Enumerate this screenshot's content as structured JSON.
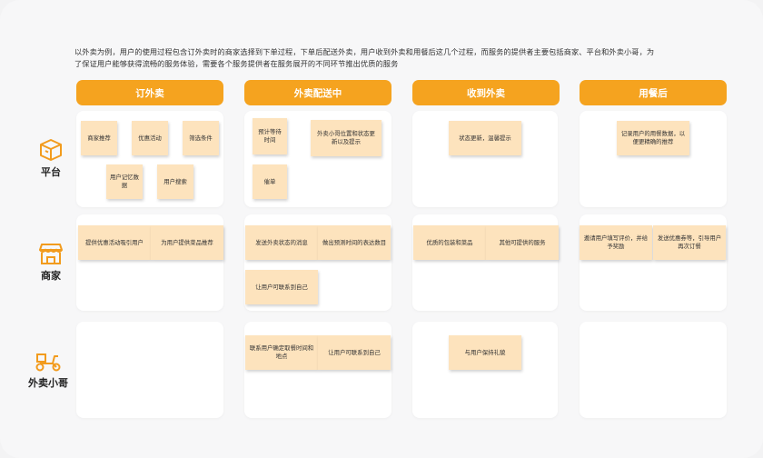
{
  "intro": {
    "line1": "以外卖为例，用户的使用过程包含订外卖时的商家选择到下单过程，下单后配送外卖，用户收到外卖和用餐后这几个过程，而服务的提供者主要包括商家、平台和外卖小哥，为",
    "line2": "了保证用户能够获得流畅的服务体验，需要各个服务提供者在服务展开的不同环节推出优质的服务"
  },
  "stages": [
    "订外卖",
    "外卖配送中",
    "收到外卖",
    "用餐后"
  ],
  "roles": [
    {
      "label": "平台",
      "icon": "store-box-icon"
    },
    {
      "label": "商家",
      "icon": "shop-icon"
    },
    {
      "label": "外卖小哥",
      "icon": "scooter-icon"
    }
  ],
  "notes": {
    "platform_order": [
      "商家推荐",
      "优惠活动",
      "筛选条件",
      "用户记忆数据",
      "用户搜索"
    ],
    "platform_delivery": [
      "预计等待时间",
      "外卖小哥位置和状态更新以及提示",
      "催单"
    ],
    "platform_receive": [
      "状态更新，温馨提示"
    ],
    "platform_after": [
      "记录用户的用餐数据，以便更精确的推荐"
    ],
    "merchant_order": [
      "提供优惠活动吸引用户",
      "为用户提供菜品推荐"
    ],
    "merchant_delivery": [
      "发送外卖状态的消息",
      "做出预测时间的表达数目",
      "让用户可联系到自己"
    ],
    "merchant_receive": [
      "优质的包装和菜品",
      "其他可提供的服务"
    ],
    "merchant_after": [
      "邀请用户填写评价，并给予奖励",
      "发送优惠券等，引导用户再次订餐"
    ],
    "courier_delivery": [
      "联系用户确定取餐时间和地点",
      "让用户可联系到自己"
    ],
    "courier_receive": [
      "与用户保持礼貌"
    ]
  },
  "colors": {
    "stage": "#f5a31f",
    "note": "#fde3bd",
    "icon": "#f29b1d"
  }
}
